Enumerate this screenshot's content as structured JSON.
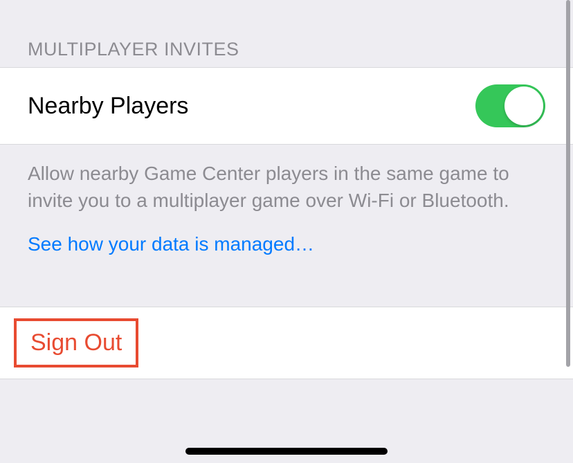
{
  "section": {
    "header": "MULTIPLAYER INVITES",
    "row": {
      "label": "Nearby Players",
      "toggle_on": true
    },
    "footer": "Allow nearby Game Center players in the same game to invite you to a multiplayer game over Wi-Fi or Bluetooth.",
    "link": "See how your data is managed…"
  },
  "sign_out": {
    "label": "Sign Out"
  }
}
